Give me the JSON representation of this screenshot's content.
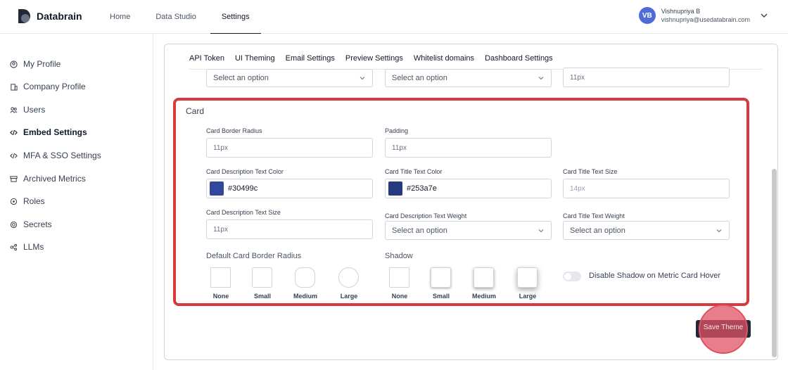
{
  "app": {
    "name": "Databrain"
  },
  "nav": {
    "home": "Home",
    "data_studio": "Data Studio",
    "settings": "Settings"
  },
  "user": {
    "initials": "VB",
    "name": "Vishnupriya B",
    "email": "vishnupriya@usedatabrain.com"
  },
  "sidebar": {
    "items": [
      {
        "label": "My Profile",
        "icon": "user-circle-icon"
      },
      {
        "label": "Company Profile",
        "icon": "building-icon"
      },
      {
        "label": "Users",
        "icon": "users-icon"
      },
      {
        "label": "Embed Settings",
        "icon": "code-icon",
        "active": true
      },
      {
        "label": "MFA & SSO Settings",
        "icon": "code-icon"
      },
      {
        "label": "Archived Metrics",
        "icon": "archive-icon"
      },
      {
        "label": "Roles",
        "icon": "roles-icon"
      },
      {
        "label": "Secrets",
        "icon": "secret-icon"
      },
      {
        "label": "LLMs",
        "icon": "llm-icon"
      }
    ]
  },
  "tabs": [
    "API Token",
    "UI Theming",
    "Email Settings",
    "Preview Settings",
    "Whitelist domains",
    "Dashboard Settings"
  ],
  "top_row": {
    "select1": "Select an option",
    "select2": "Select an option",
    "input3": "11px"
  },
  "card": {
    "title": "Card",
    "border_radius": {
      "label": "Card Border Radius",
      "value": "11px"
    },
    "padding": {
      "label": "Padding",
      "value": "11px"
    },
    "desc_color": {
      "label": "Card Description Text Color",
      "value": "#30499c"
    },
    "title_color": {
      "label": "Card Title Text Color",
      "value": "#253a7e"
    },
    "title_size": {
      "label": "Card Title Text Size",
      "placeholder": "14px"
    },
    "desc_size": {
      "label": "Card Description Text Size",
      "value": "11px"
    },
    "desc_weight": {
      "label": "Card Description Text Weight",
      "value": "Select an option"
    },
    "title_weight": {
      "label": "Card Title Text Weight",
      "value": "Select an option"
    },
    "default_radius": {
      "label": "Default Card Border Radius",
      "options": [
        "None",
        "Small",
        "Medium",
        "Large"
      ]
    },
    "shadow": {
      "label": "Shadow",
      "options": [
        "None",
        "Small",
        "Medium",
        "Large"
      ]
    },
    "disable_shadow_label": "Disable Shadow on Metric Card Hover"
  },
  "save_button": "Save Theme",
  "colors": {
    "accent_red": "#d9383f",
    "avatar_blue": "#4f6bd8",
    "button_dark": "#1f2937"
  }
}
